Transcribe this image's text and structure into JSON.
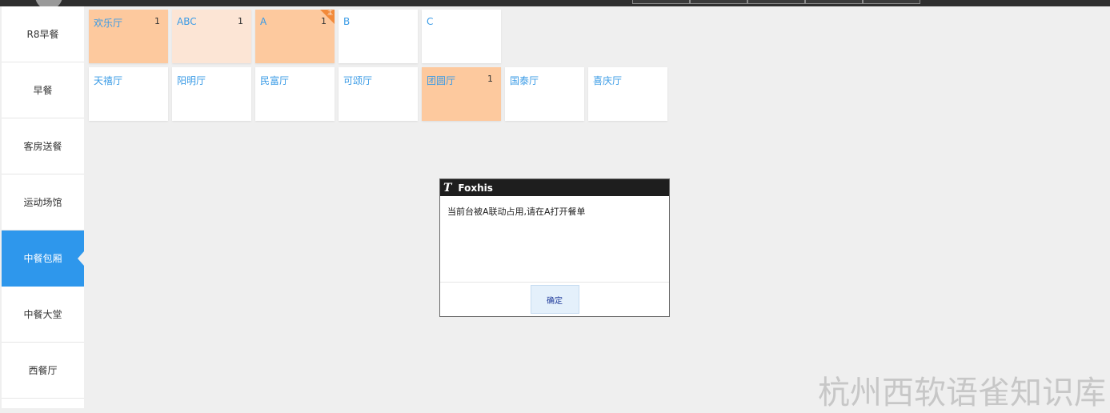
{
  "sidebar": {
    "items": [
      {
        "label": "R8早餐",
        "active": false
      },
      {
        "label": "早餐",
        "active": false
      },
      {
        "label": "客房送餐",
        "active": false
      },
      {
        "label": "运动场馆",
        "active": false
      },
      {
        "label": "中餐包厢",
        "active": true
      },
      {
        "label": "中餐大堂",
        "active": false
      },
      {
        "label": "西餐厅",
        "active": false
      }
    ]
  },
  "tables": {
    "row1": [
      {
        "name": "欢乐厅",
        "count": "1",
        "state": "occupied"
      },
      {
        "name": "ABC",
        "count": "1",
        "state": "light"
      },
      {
        "name": "A",
        "count": "1",
        "state": "occupied",
        "corner": "主"
      },
      {
        "name": "B",
        "count": "",
        "state": "empty"
      },
      {
        "name": "C",
        "count": "",
        "state": "empty"
      }
    ],
    "row2": [
      {
        "name": "天禧厅",
        "count": "",
        "state": "empty"
      },
      {
        "name": "阳明厅",
        "count": "",
        "state": "empty"
      },
      {
        "name": "民富厅",
        "count": "",
        "state": "empty"
      },
      {
        "name": "可颂厅",
        "count": "",
        "state": "empty"
      },
      {
        "name": "团圆厅",
        "count": "1",
        "state": "occupied"
      },
      {
        "name": "国泰厅",
        "count": "",
        "state": "empty"
      },
      {
        "name": "喜庆厅",
        "count": "",
        "state": "empty"
      }
    ]
  },
  "dialog": {
    "logo": "T",
    "title": "Foxhis",
    "message": "当前台被A联动占用,请在A打开餐单",
    "ok_label": "确定"
  },
  "watermark": "杭州西软语雀知识库",
  "colors": {
    "accent": "#2e97ec",
    "occupied": "#fdc99e",
    "light": "#fce5d5",
    "table_name": "#3a9be6",
    "corner": "#f28a3a"
  }
}
